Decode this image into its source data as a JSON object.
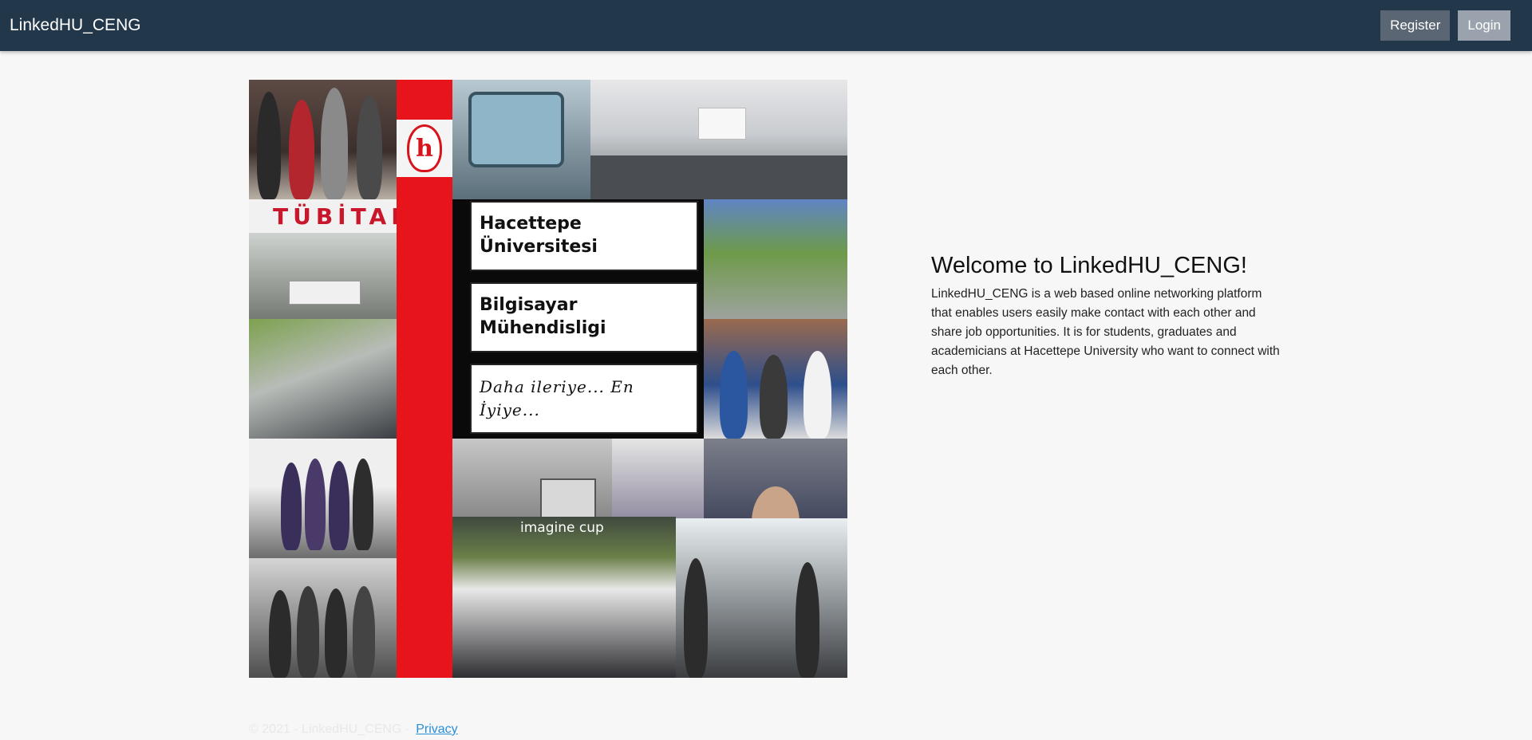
{
  "navbar": {
    "brand": "LinkedHU_CENG",
    "register_label": "Register",
    "login_label": "Login"
  },
  "collage": {
    "university_line1": "Hacettepe",
    "university_line2": "Üniversitesi",
    "department_line1": "Bilgisayar",
    "department_line2": "Mühendisligi",
    "motto": "Daha ileriye... En İyiye...",
    "tubitak": "TÜBİTAK",
    "imagine_cup": "imagine cup"
  },
  "welcome": {
    "title": "Welcome to LinkedHU_CENG!",
    "description": "LinkedHU_CENG is a web based online networking platform that enables users easily make contact with each other and share job opportunities. It is for students, graduates and academicians at Hacettepe University who want to connect with each other."
  },
  "footer": {
    "copyright": "© 2021 - LinkedHU_CENG -",
    "privacy_label": "Privacy"
  },
  "colors": {
    "navbar_bg": "#22374a",
    "register_bg": "#5a6673",
    "login_bg": "#9aa3ad",
    "brand_red": "#e8141c",
    "link": "#2a8fd6"
  }
}
